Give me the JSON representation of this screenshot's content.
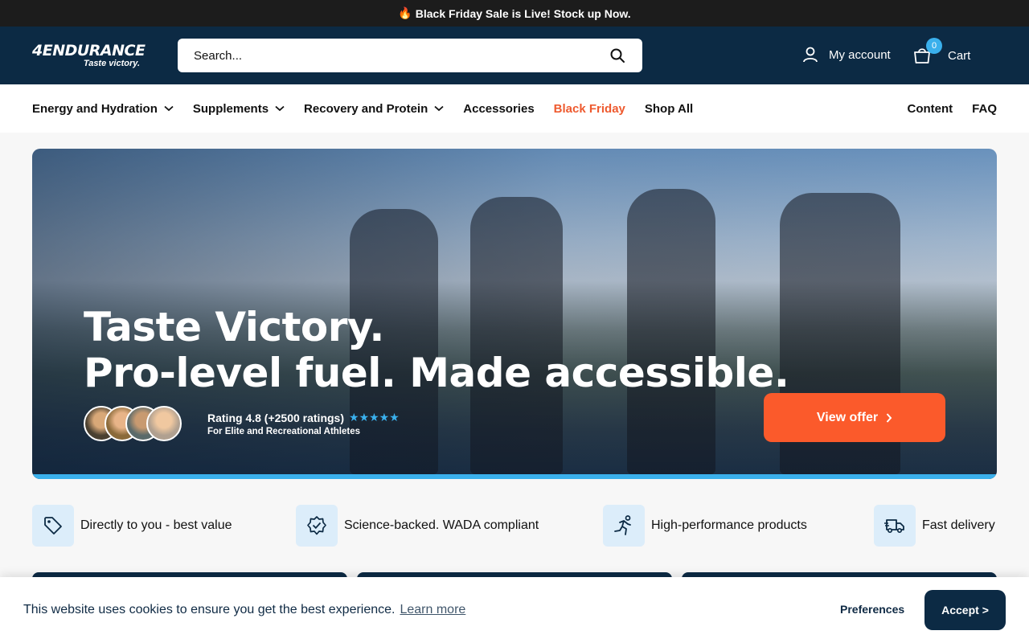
{
  "announcement": {
    "emoji": "🔥",
    "text": "Black Friday Sale is Live! Stock up Now."
  },
  "header": {
    "logo_word": "4ENDURANCE",
    "logo_tagline": "Taste victory.",
    "search_placeholder": "Search...",
    "account_label": "My account",
    "cart_label": "Cart",
    "cart_count": "0"
  },
  "nav": {
    "items": [
      {
        "label": "Energy and Hydration",
        "dropdown": true
      },
      {
        "label": "Supplements",
        "dropdown": true
      },
      {
        "label": "Recovery and Protein",
        "dropdown": true
      },
      {
        "label": "Accessories",
        "dropdown": false
      },
      {
        "label": "Black Friday",
        "dropdown": false,
        "highlight_color": "#ee5a2f"
      },
      {
        "label": "Shop All",
        "dropdown": false
      }
    ],
    "right_items": [
      "Content",
      "FAQ"
    ]
  },
  "hero": {
    "title_line1": "Taste Victory.",
    "title_line2": "Pro-level fuel. Made accessible.",
    "rating_text": "Rating 4.8 (+2500 ratings)",
    "rating_stars": "★★★★★",
    "rating_sub": "For Elite and Recreational Athletes",
    "cta_label": "View offer",
    "accent_color": "#3ab0ec",
    "cta_color": "#fb5a2b"
  },
  "features": [
    {
      "icon": "price-tag-icon",
      "label": "Directly to you - best value"
    },
    {
      "icon": "verified-badge-icon",
      "label": "Science-backed. WADA compliant"
    },
    {
      "icon": "runner-icon",
      "label": "High-performance products"
    },
    {
      "icon": "delivery-truck-icon",
      "label": "Fast delivery"
    }
  ],
  "cookie": {
    "text": "This website uses cookies to ensure you get the best experience.",
    "link": "Learn more",
    "preferences": "Preferences",
    "accept": "Accept >"
  },
  "colors": {
    "brand_navy": "#0c2a44",
    "accent_blue": "#3ab0ec",
    "cta_orange": "#fb5a2b"
  }
}
